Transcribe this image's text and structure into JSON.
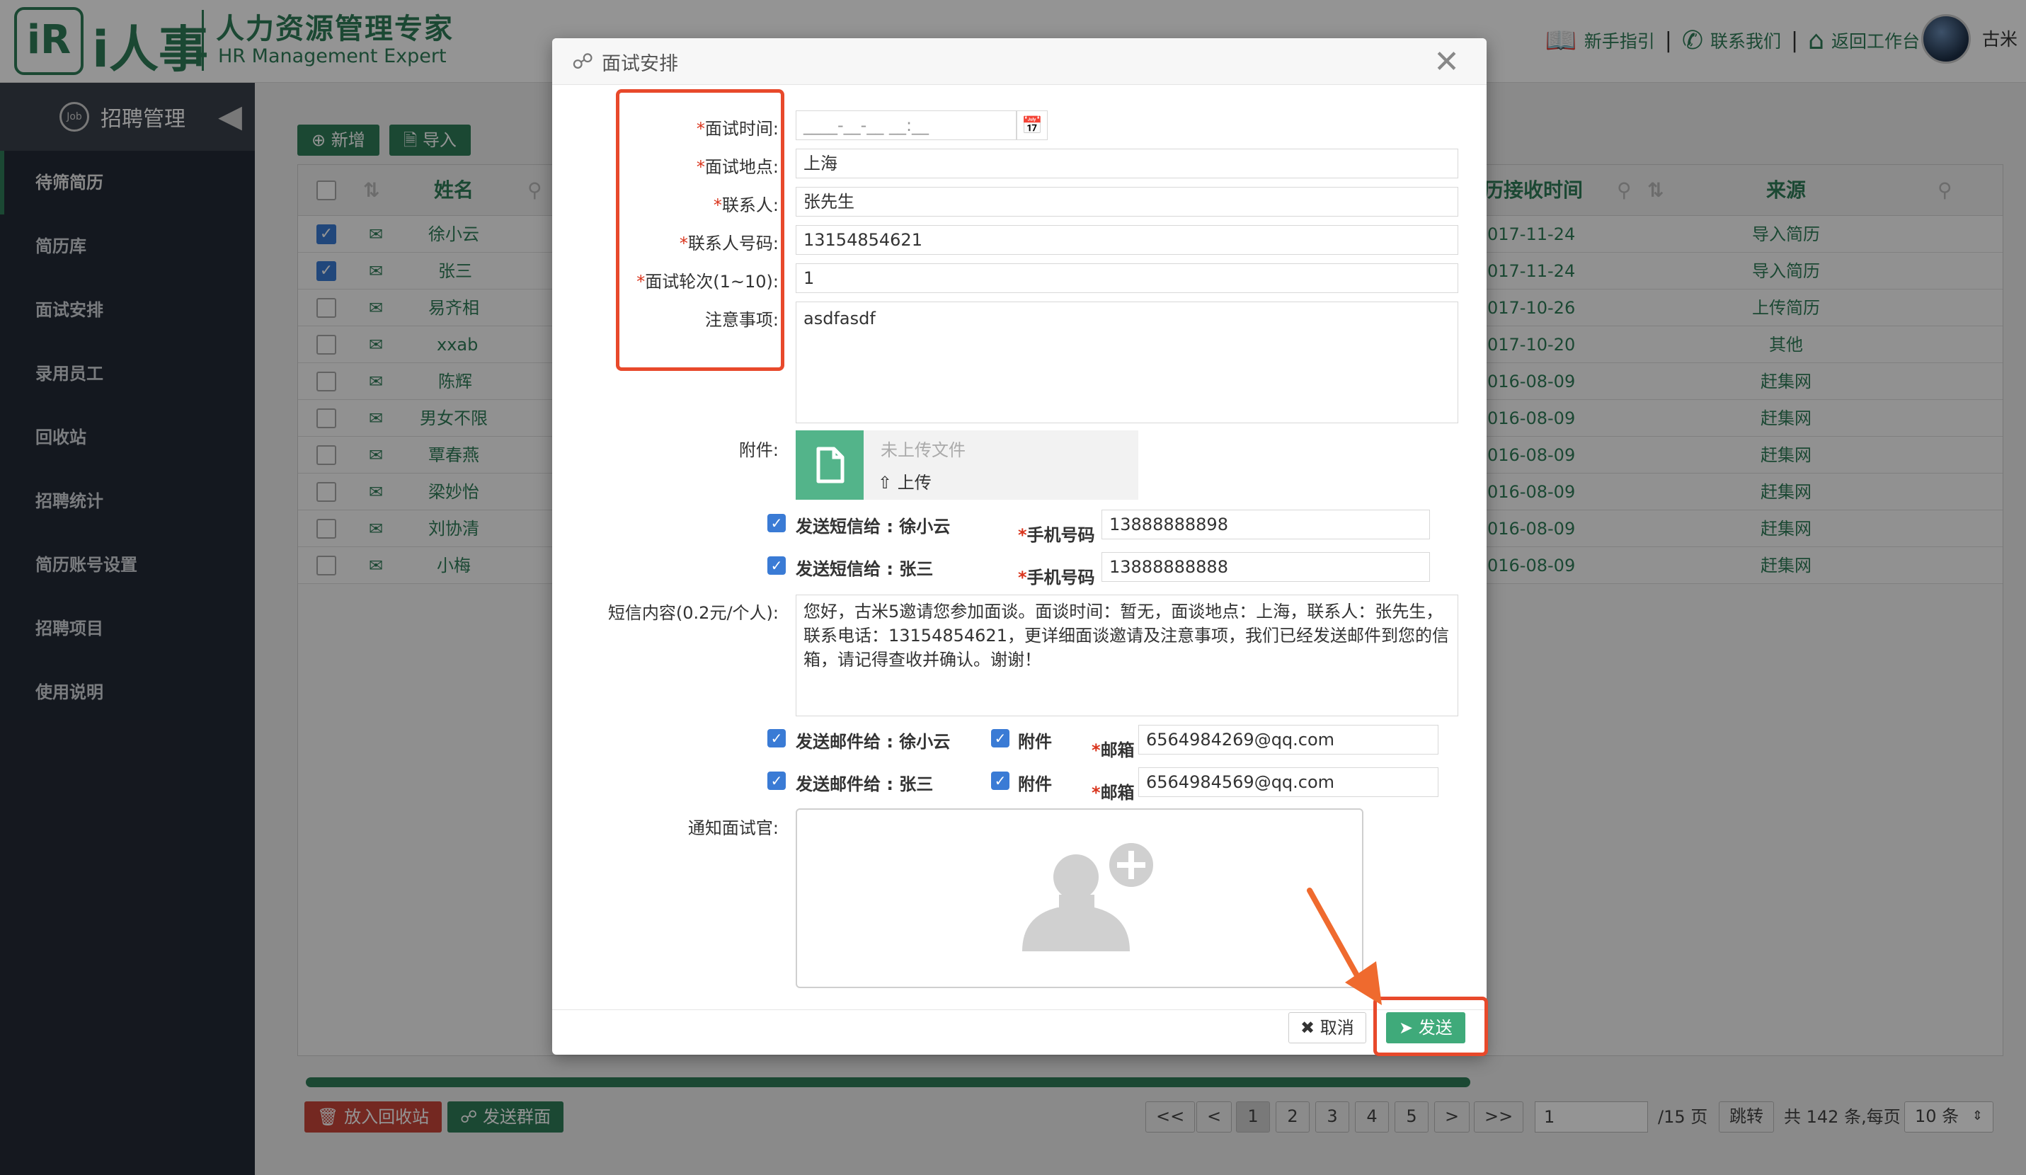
{
  "header": {
    "logo_mark": "iR",
    "logo_name": "i人事",
    "title": "人力资源管理专家",
    "subtitle": "HR Management Expert",
    "links": [
      "新手指引",
      "联系我们",
      "返回工作台"
    ],
    "user_name": "古米"
  },
  "sidebar": {
    "title": "招聘管理",
    "items": [
      "待筛简历",
      "简历库",
      "面试安排",
      "录用员工",
      "回收站",
      "招聘统计",
      "简历账号设置",
      "招聘项目",
      "使用说明"
    ]
  },
  "toolbar": {
    "add": "新增",
    "import": "导入"
  },
  "grid": {
    "col_name": "姓名",
    "col_time": "历接收时间",
    "col_source": "来源",
    "rows": [
      {
        "name": "徐小云",
        "date": "017-11-24",
        "source": "导入简历"
      },
      {
        "name": "张三",
        "date": "017-11-24",
        "source": "导入简历"
      },
      {
        "name": "易齐相",
        "date": "017-10-26",
        "source": "上传简历"
      },
      {
        "name": "xxab",
        "date": "017-10-20",
        "source": "其他"
      },
      {
        "name": "陈辉",
        "date": "016-08-09",
        "source": "赶集网"
      },
      {
        "name": "男女不限",
        "date": "016-08-09",
        "source": "赶集网"
      },
      {
        "name": "覃春燕",
        "date": "016-08-09",
        "source": "赶集网"
      },
      {
        "name": "梁妙怡",
        "date": "016-08-09",
        "source": "赶集网"
      },
      {
        "name": "刘协清",
        "date": "016-08-09",
        "source": "赶集网"
      },
      {
        "name": "小梅",
        "date": "016-08-09",
        "source": "赶集网"
      }
    ]
  },
  "bottom": {
    "recycle": "放入回收站",
    "group_send": "发送群面",
    "pager": {
      "first": "<<",
      "prev": "<",
      "pages": [
        "1",
        "2",
        "3",
        "4",
        "5"
      ],
      "next": ">",
      "last": ">>",
      "page_input": "1",
      "total_pages": "/15 页",
      "jump": "跳转",
      "summary": "共 142 条,每页",
      "per_page": "10 条"
    }
  },
  "modal": {
    "title": "面试安排",
    "labels": {
      "time": "面试时间:",
      "place": "面试地点:",
      "contact": "联系人:",
      "contact_phone": "联系人号码:",
      "round": "面试轮次(1~10):",
      "notes": "注意事项:",
      "attachment": "附件:",
      "sms_content": "短信内容(0.2元/个人):",
      "notify": "通知面试官:"
    },
    "values": {
      "time_placeholder": "____-__-__ __:__",
      "place": "上海",
      "contact": "张先生",
      "contact_phone": "13154854621",
      "round": "1",
      "notes": "asdfasdf"
    },
    "upload": {
      "none": "未上传文件",
      "upload": "上传"
    },
    "sms": [
      {
        "label": "发送短信给 : 徐小云",
        "phone_label": "手机号码",
        "phone": "13888888898"
      },
      {
        "label": "发送短信给 : 张三",
        "phone_label": "手机号码",
        "phone": "13888888888"
      }
    ],
    "sms_text": "您好，古米5邀请您参加面谈。面谈时间：暂无，面谈地点：上海，联系人：张先生，联系电话：13154854621，更详细面谈邀请及注意事项，我们已经发送邮件到您的信箱，请记得查收并确认。谢谢！",
    "email": [
      {
        "label": "发送邮件给 : 徐小云",
        "attach": "附件",
        "email_label": "邮箱",
        "email": "6564984269@qq.com"
      },
      {
        "label": "发送邮件给 : 张三",
        "attach": "附件",
        "email_label": "邮箱",
        "email": "6564984569@qq.com"
      }
    ],
    "cancel": "取消",
    "send": "发送"
  },
  "colors": {
    "brand": "#2f7d58",
    "highlight": "#e8492b",
    "checkbox": "#3a7bd5"
  }
}
